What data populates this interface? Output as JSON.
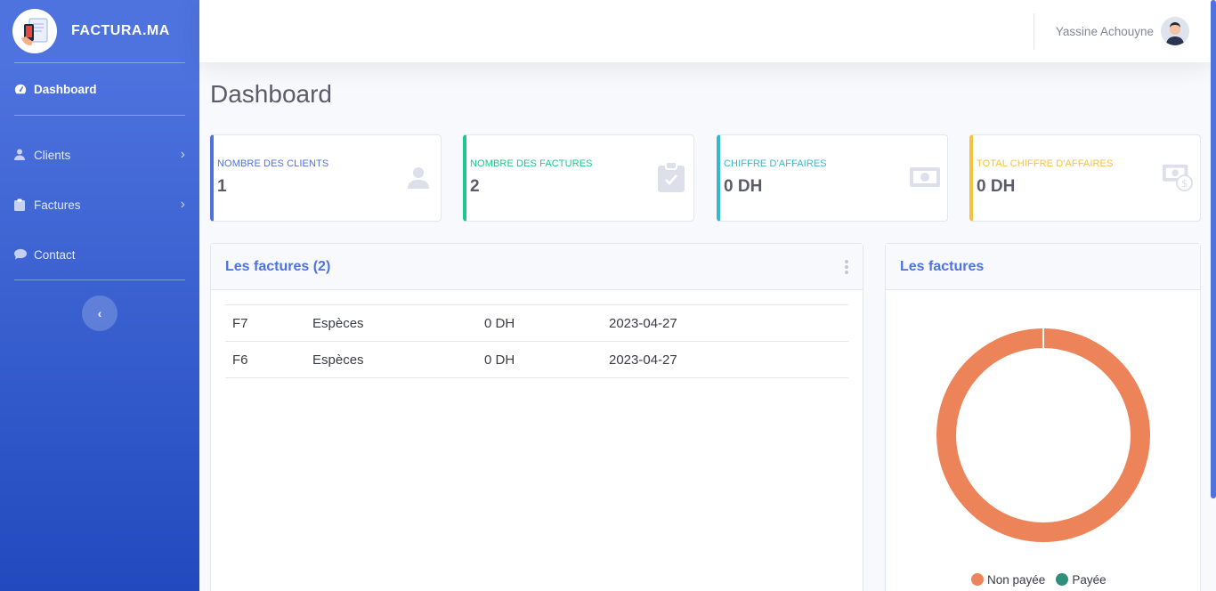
{
  "brand": {
    "name": "FACTURA.MA"
  },
  "sidebar": {
    "items": [
      {
        "label": "Dashboard",
        "icon": "tachometer-icon",
        "active": true
      },
      {
        "label": "Clients",
        "icon": "user-icon"
      },
      {
        "label": "Factures",
        "icon": "clipboard-icon"
      },
      {
        "label": "Contact",
        "icon": "comment-icon"
      }
    ],
    "toggle_icon": "chevron-left-icon"
  },
  "topbar": {
    "user_name": "Yassine Achouyne"
  },
  "page": {
    "title": "Dashboard"
  },
  "stats": [
    {
      "label": "Nombre des clients",
      "value": "1",
      "color": "#4e73df",
      "icon": "user-icon"
    },
    {
      "label": "Nombre des factures",
      "value": "2",
      "color": "#1cc88a",
      "icon": "clipboard-check-icon"
    },
    {
      "label": "Chiffre d'affaires",
      "value": "0 DH",
      "color": "#36b9cc",
      "icon": "money-bill-icon"
    },
    {
      "label": "Total chiffre d'affaires",
      "value": "0 DH",
      "color": "#f6c23e",
      "icon": "money-check-dollar-icon"
    }
  ],
  "invoices_panel": {
    "title": "Les factures (2)",
    "rows": [
      {
        "ref": "F7",
        "method": "Espèces",
        "amount": "0 DH",
        "date": "2023-04-27"
      },
      {
        "ref": "F6",
        "method": "Espèces",
        "amount": "0 DH",
        "date": "2023-04-27"
      }
    ]
  },
  "chart_panel": {
    "title": "Les factures",
    "chart_data": {
      "type": "pie",
      "labels": [
        "Non payée",
        "Payée"
      ],
      "values": [
        2,
        0
      ],
      "colors": [
        "#ed8358",
        "#2f8f7a"
      ],
      "donut": true,
      "legend": "bottom"
    }
  }
}
